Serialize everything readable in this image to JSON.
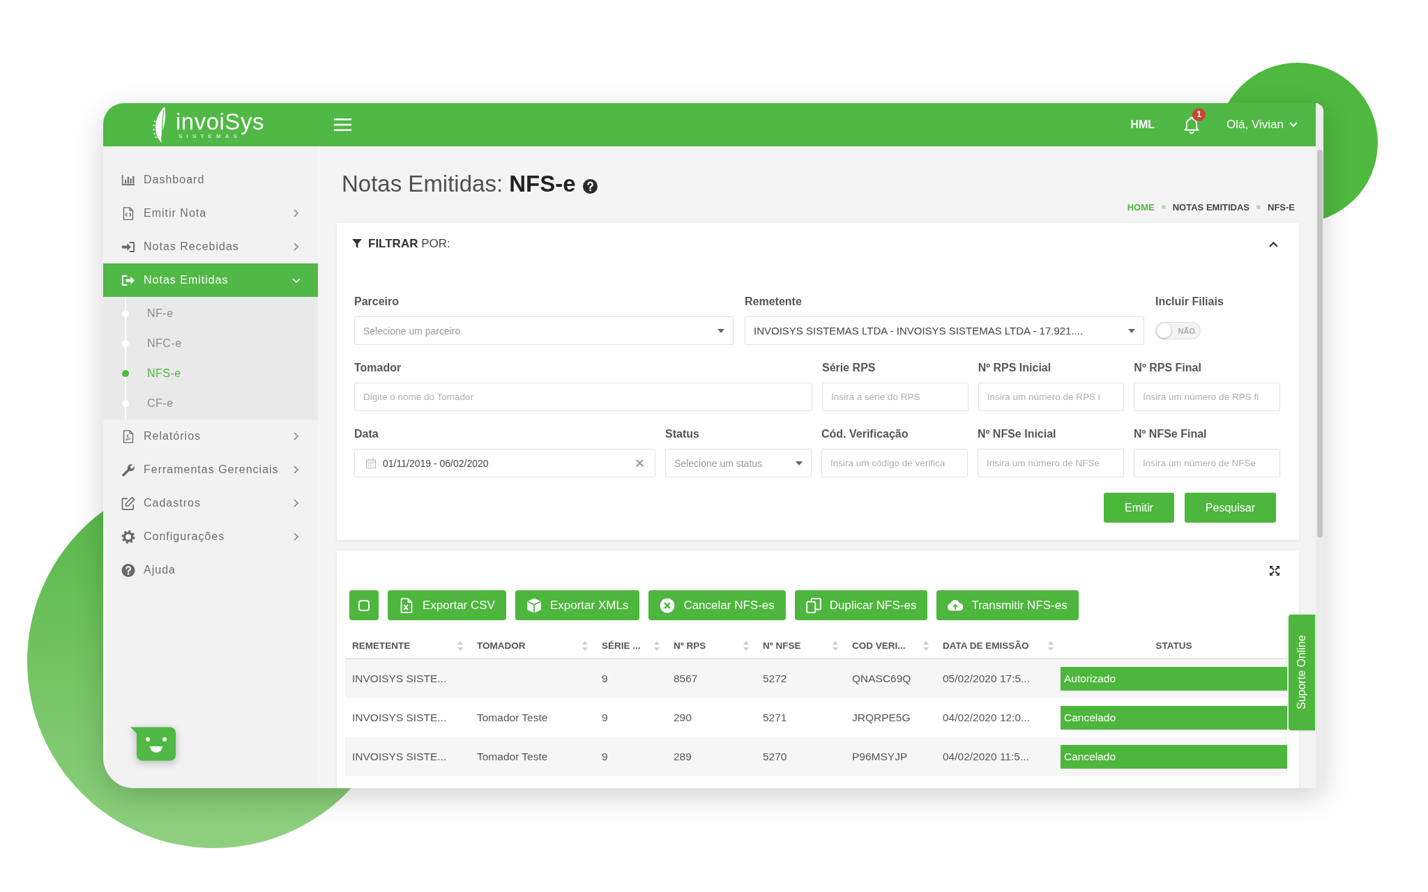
{
  "header": {
    "logo": {
      "name": "invoiSys",
      "tagline": "SISTEMAS"
    },
    "environment": "HML",
    "notification_count": "1",
    "user": "Olá, Vivian"
  },
  "sidebar": {
    "items": [
      {
        "label": "Dashboard",
        "kind": "link",
        "selected": false
      },
      {
        "label": "Emitir Nota",
        "kind": "menu",
        "expanded": false,
        "selected": false
      },
      {
        "label": "Notas Recebidas",
        "kind": "menu",
        "expanded": false,
        "selected": false
      },
      {
        "label": "Notas Emitidas",
        "kind": "menu",
        "expanded": true,
        "selected": true,
        "children": [
          {
            "label": "NF-e",
            "selected": false
          },
          {
            "label": "NFC-e",
            "selected": false
          },
          {
            "label": "NFS-e",
            "selected": true
          },
          {
            "label": "CF-e",
            "selected": false
          }
        ]
      },
      {
        "label": "Relatórios",
        "kind": "menu",
        "expanded": false,
        "selected": false
      },
      {
        "label": "Ferramentas Gerenciais",
        "kind": "menu",
        "expanded": false,
        "selected": false
      },
      {
        "label": "Cadastros",
        "kind": "menu",
        "expanded": false,
        "selected": false
      },
      {
        "label": "Configurações",
        "kind": "menu",
        "expanded": false,
        "selected": false
      },
      {
        "label": "Ajuda",
        "kind": "link",
        "selected": false
      }
    ]
  },
  "page": {
    "title": "Notas Emitidas: **NFS-e**",
    "breadcrumb": [
      {
        "label": "HOME",
        "kind": "link"
      },
      {
        "label": "NOTAS EMITIDAS",
        "kind": "text"
      },
      {
        "label": "NFS-E",
        "kind": "text"
      }
    ]
  },
  "filter": {
    "title": "**FILTRAR** POR:",
    "expanded": true,
    "fields": [
      {
        "label": "Parceiro",
        "kind": "select",
        "placeholder": "Selecione um parceiro"
      },
      {
        "label": "Remetente",
        "kind": "select",
        "value": "INVOISYS SISTEMAS LTDA - INVOISYS SISTEMAS LTDA - 17.921...."
      },
      {
        "label": "Incluir Filiais",
        "kind": "toggle",
        "on": false,
        "text": "NÃO"
      },
      {
        "label": "Tomador",
        "kind": "text",
        "placeholder": "Digite o nome do Tomador"
      },
      {
        "label": "Série RPS",
        "kind": "text",
        "placeholder": "Insira a série do RPS"
      },
      {
        "label": "Nº RPS Inicial",
        "kind": "text",
        "placeholder": "Insira um número de RPS i"
      },
      {
        "label": "Nº RPS Final",
        "kind": "text",
        "placeholder": "Insira um número de RPS fi"
      },
      {
        "label": "Data",
        "kind": "daterange",
        "value": "01/11/2019 - 06/02/2020"
      },
      {
        "label": "Status",
        "kind": "select",
        "placeholder": "Selecione um status"
      },
      {
        "label": "Cód. Verificação",
        "kind": "text",
        "placeholder": "Insira um código de verifica"
      },
      {
        "label": "Nº NFSe Inicial",
        "kind": "text",
        "placeholder": "Insira um número de NFSe"
      },
      {
        "label": "Nº NFSe Final",
        "kind": "text",
        "placeholder": "Insira um número de NFSe"
      }
    ],
    "buttons": [
      "Emitir",
      "Pesquisar"
    ]
  },
  "table": {
    "select_all": {
      "checked": false
    },
    "actions": [
      "Exportar CSV",
      "Exportar XMLs",
      "Cancelar NFS-es",
      "Duplicar NFS-es",
      "Transmitir NFS-es"
    ],
    "columns": [
      {
        "label": "REMETENTE",
        "sortable": true
      },
      {
        "label": "TOMADOR",
        "sortable": true
      },
      {
        "label": "SÉRIE ...",
        "sortable": true
      },
      {
        "label": "Nº RPS",
        "sortable": true
      },
      {
        "label": "Nº NFSE",
        "sortable": true
      },
      {
        "label": "COD VERI...",
        "sortable": true
      },
      {
        "label": "DATA DE EMISSÃO",
        "sortable": true
      },
      {
        "label": "STATUS",
        "sortable": false
      }
    ],
    "rows": [
      {
        "remetente": "INVOISYS SISTE...",
        "serie": "9",
        "rps": "8567",
        "nfse": "5272",
        "cod_verificacao": "QNASC69Q",
        "data_emissao": "05/02/2020 17:5...",
        "status": "Autorizado"
      },
      {
        "remetente": "INVOISYS SISTE...",
        "tomador": "Tomador Teste",
        "serie": "9",
        "rps": "290",
        "nfse": "5271",
        "cod_verificacao": "JRQRPE5G",
        "data_emissao": "04/02/2020 12:0...",
        "status": "Cancelado"
      },
      {
        "remetente": "INVOISYS SISTE...",
        "tomador": "Tomador Teste",
        "serie": "9",
        "rps": "289",
        "nfse": "5270",
        "cod_verificacao": "P96MSYJP",
        "data_emissao": "04/02/2020 11:5...",
        "status": "Cancelado"
      }
    ]
  },
  "support_tab": "Suporte Online"
}
